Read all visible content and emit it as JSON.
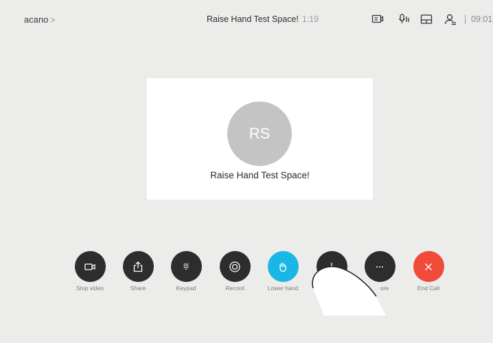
{
  "header": {
    "brand": "acano",
    "brand_chevron": ">",
    "meeting_title": "Raise Hand Test Space!",
    "duration": "1:19",
    "clock": "09:01",
    "icons": [
      "self-view-icon",
      "microphone-icon",
      "layout-icon",
      "participants-icon"
    ]
  },
  "card": {
    "initials": "RS",
    "name": "Raise Hand Test Space!"
  },
  "controls": [
    {
      "label": "Stop video",
      "icon": "video-camera-icon"
    },
    {
      "label": "Share",
      "icon": "share-icon"
    },
    {
      "label": "Keypad",
      "icon": "keypad-icon"
    },
    {
      "label": "Record",
      "icon": "record-icon"
    },
    {
      "label": "Lower hand",
      "icon": "hand-icon",
      "active": true
    },
    {
      "label": "",
      "icon": "add-icon"
    },
    {
      "label": "ore",
      "icon": "more-icon"
    },
    {
      "label": "End Call",
      "icon": "close-icon"
    }
  ],
  "colors": {
    "background": "#ececeb",
    "button": "#2d2d2d",
    "active_button": "#1ab7e6",
    "end_call": "#f04b3a"
  }
}
